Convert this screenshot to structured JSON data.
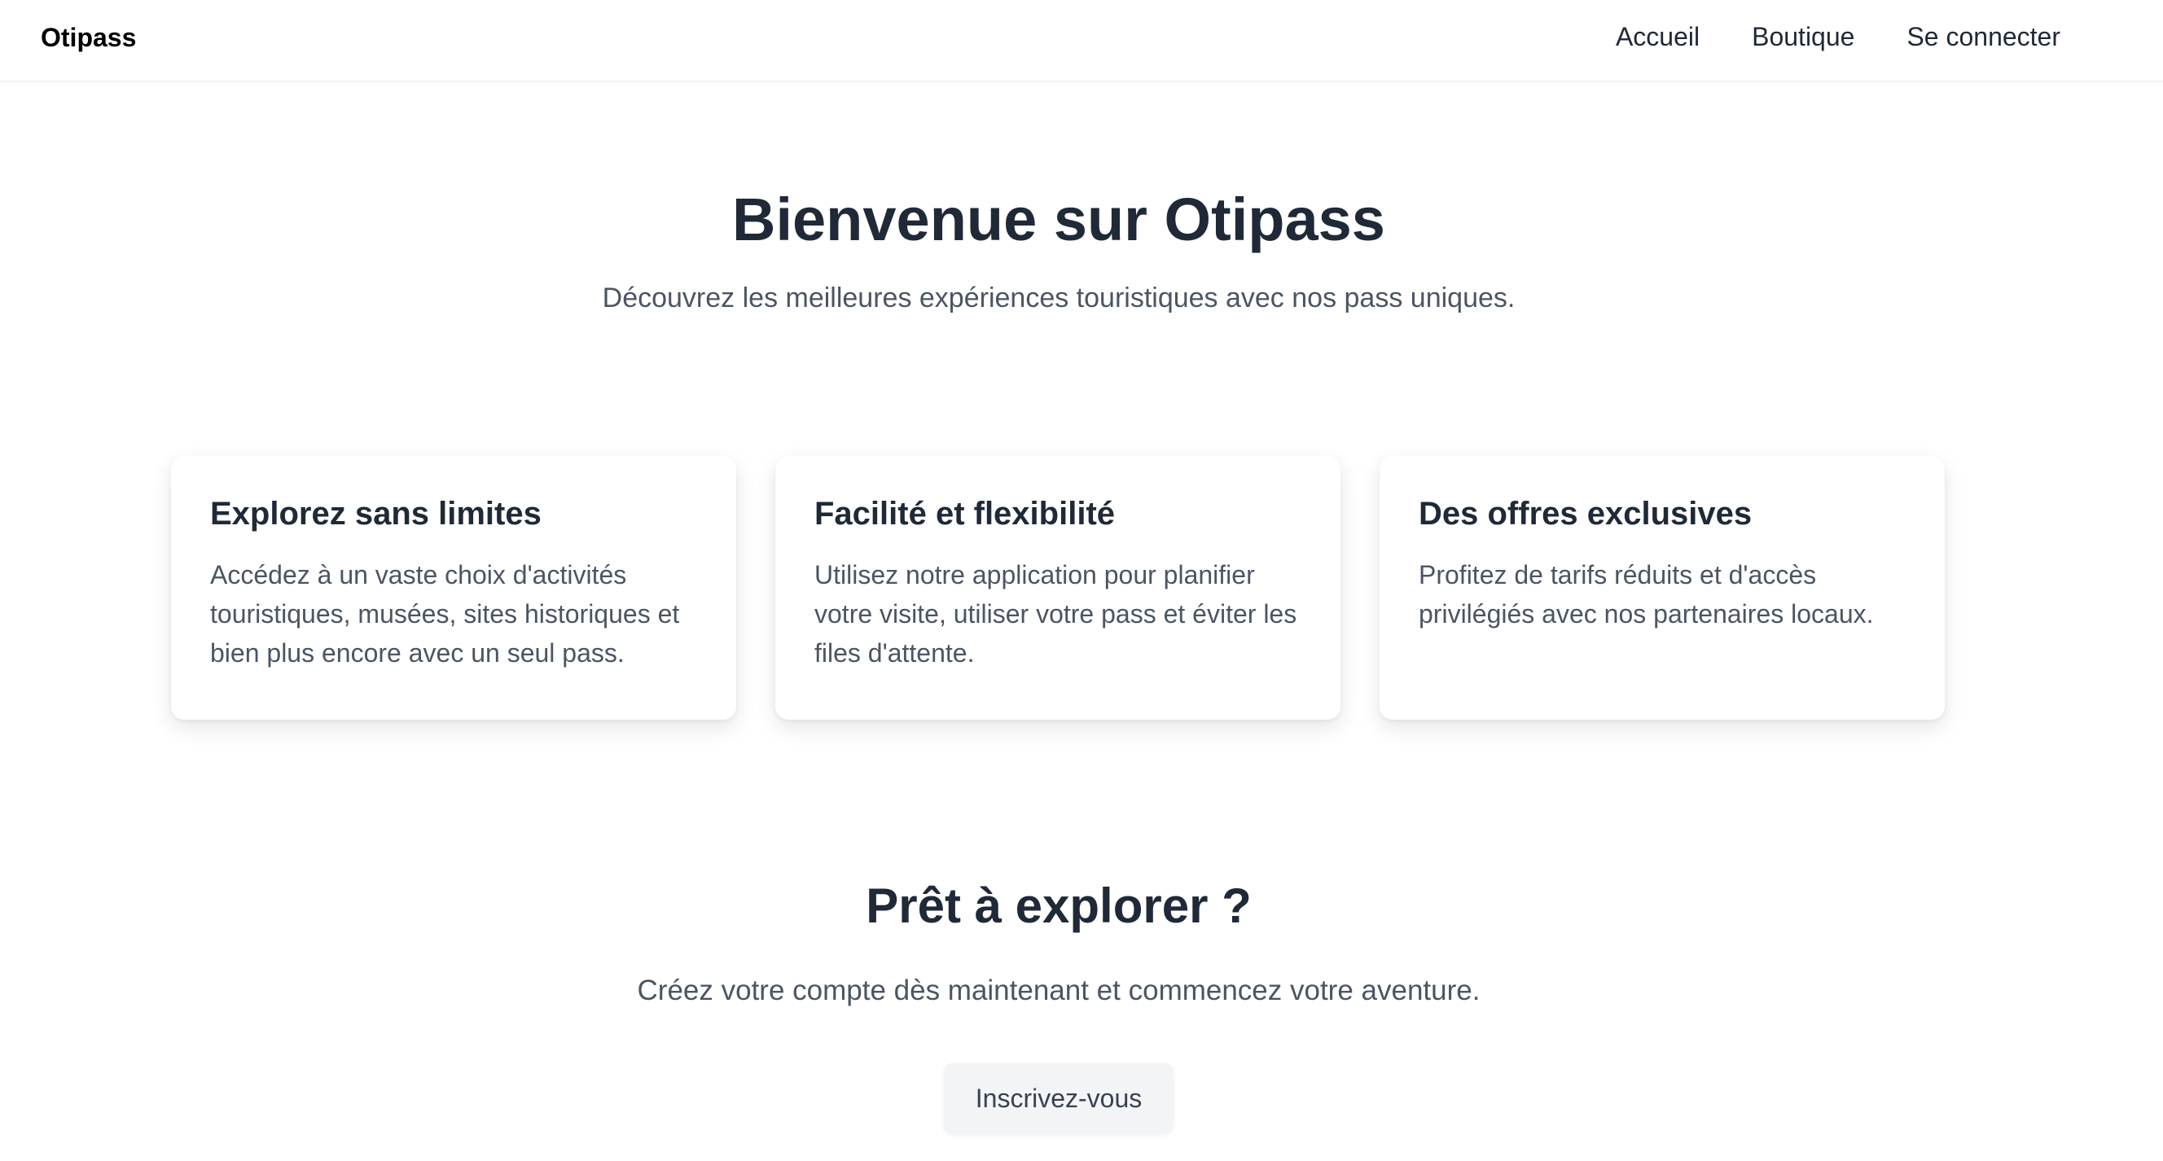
{
  "nav": {
    "brand": "Otipass",
    "links": [
      {
        "label": "Accueil"
      },
      {
        "label": "Boutique"
      },
      {
        "label": "Se connecter"
      }
    ]
  },
  "hero": {
    "title": "Bienvenue sur Otipass",
    "subtitle": "Découvrez les meilleures expériences touristiques avec nos pass uniques."
  },
  "features": [
    {
      "title": "Explorez sans limites",
      "text": "Accédez à un vaste choix d'activités touristiques, musées, sites historiques et bien plus encore avec un seul pass."
    },
    {
      "title": "Facilité et flexibilité",
      "text": "Utilisez notre application pour planifier votre visite, utiliser votre pass et éviter les files d'attente."
    },
    {
      "title": "Des offres exclusives",
      "text": "Profitez de tarifs réduits et d'accès privilégiés avec nos partenaires locaux."
    }
  ],
  "cta": {
    "title": "Prêt à explorer ?",
    "subtitle": "Créez votre compte dès maintenant et commencez votre aventure.",
    "button_label": "Inscrivez-vous"
  }
}
